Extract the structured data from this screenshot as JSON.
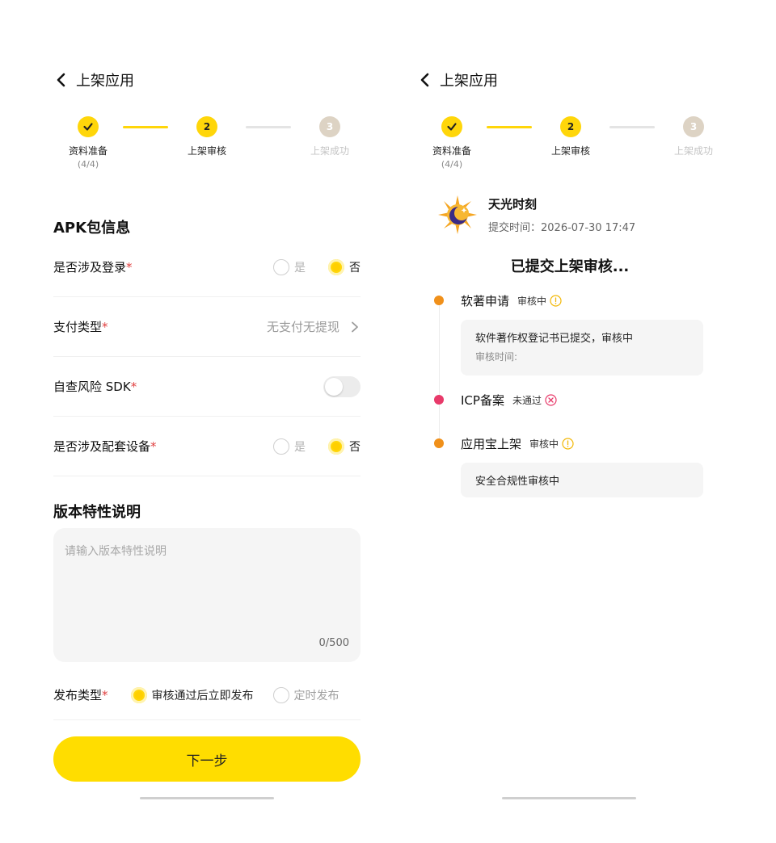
{
  "left": {
    "header": {
      "title": "上架应用"
    },
    "steps": [
      {
        "label": "资料准备",
        "sub": "(4/4)",
        "mark": "✓"
      },
      {
        "label": "上架审核",
        "mark": "2"
      },
      {
        "label": "上架成功",
        "mark": "3"
      }
    ],
    "apk_section_title": "APK包信息",
    "rows": {
      "login": {
        "label": "是否涉及登录",
        "req": "*",
        "opt_yes": "是",
        "opt_no": "否",
        "selected": "否"
      },
      "pay": {
        "label": "支付类型",
        "req": "*",
        "value": "无支付无提现"
      },
      "sdk": {
        "label": "自查风险 SDK",
        "req": "*",
        "enabled": false
      },
      "device": {
        "label": "是否涉及配套设备",
        "req": "*",
        "opt_yes": "是",
        "opt_no": "否",
        "selected": "否"
      }
    },
    "version_section_title": "版本特性说明",
    "version_input": {
      "placeholder": "请输入版本特性说明",
      "counter": "0/500"
    },
    "publish": {
      "label": "发布类型",
      "req": "*",
      "option_immediate": "审核通过后立即发布",
      "option_scheduled": "定时发布",
      "selected": "审核通过后立即发布"
    },
    "next_button": "下一步"
  },
  "right": {
    "header": {
      "title": "上架应用"
    },
    "steps": [
      {
        "label": "资料准备",
        "sub": "(4/4)",
        "mark": "✓"
      },
      {
        "label": "上架审核",
        "mark": "2"
      },
      {
        "label": "上架成功",
        "mark": "3"
      }
    ],
    "app": {
      "name": "天光时刻",
      "submit_time": "提交时间：2026-07-30 17:47"
    },
    "status_title": "已提交上架审核...",
    "timeline": [
      {
        "name": "软著申请",
        "status": "审核中",
        "detail": "软件著作权登记书已提交，审核中",
        "detail_sub": "审核时间:"
      },
      {
        "name": "ICP备案",
        "status": "未通过"
      },
      {
        "name": "应用宝上架",
        "status": "审核中",
        "detail": "安全合规性审核中"
      }
    ]
  },
  "colors": {
    "accent": "#ffdd00",
    "pending": "#f0901a",
    "rejected": "#e83a6a",
    "required": "#e04040"
  }
}
